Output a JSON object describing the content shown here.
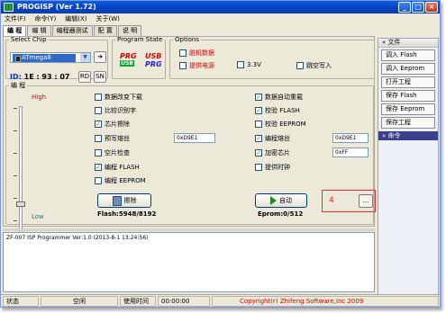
{
  "window": {
    "title": "PROGISP (Ver 1.72)"
  },
  "menu": [
    "文件(F)",
    "命令(Y)",
    "编辑(X)",
    "关于(W)"
  ],
  "tabs": [
    "编 程",
    "编 辑",
    "编程器测试",
    "配 置",
    "说 明"
  ],
  "select_chip": {
    "legend": "Select Chip",
    "chip": "ATmega8",
    "id_label": "ID:",
    "id_value": "1E : 93 : 07",
    "rd": "RD",
    "sn": "SN"
  },
  "program_state": {
    "legend": "Program State",
    "prg_top": "PRG",
    "prg_bottom": "USB",
    "usb_top": "USB",
    "usb_bottom": "PRG"
  },
  "options": {
    "legend": "Options",
    "offline_data": "脱机数据",
    "supply_power": "提供电源",
    "voltage": "3.3V",
    "empty_write": "跳空写入"
  },
  "program": {
    "legend": "编 程",
    "high": "High",
    "low": "Low",
    "left_checks": [
      {
        "label": "数据改变下载",
        "checked": false
      },
      {
        "label": "比较识别字",
        "checked": false
      },
      {
        "label": "芯片擦除",
        "checked": true
      },
      {
        "label": "预写熔丝",
        "checked": false
      },
      {
        "label": "空片检查",
        "checked": false
      },
      {
        "label": "编程 FLASH",
        "checked": true
      },
      {
        "label": "编程 EEPROM",
        "checked": false
      }
    ],
    "right_checks": [
      {
        "label": "数据自动重载",
        "checked": true
      },
      {
        "label": "校验 FLASH",
        "checked": true
      },
      {
        "label": "校验 EEPROM",
        "checked": false
      },
      {
        "label": "编程熔丝",
        "checked": true
      },
      {
        "label": "加密芯片",
        "checked": true
      },
      {
        "label": "提供时钟",
        "checked": false
      }
    ],
    "prefuse_hex": "0xD9E1",
    "fuse_hex": "0xD9E1",
    "lock_hex": "0xFF",
    "erase_button": "擦除",
    "auto_button": "自动",
    "flash_usage": "Flash:5948/8192",
    "eprom_usage": "Eprom:0/512",
    "red_number": "4",
    "dots_button": "..."
  },
  "sidebar": {
    "file_header": "文件",
    "items": [
      "调入 Flash",
      "调入 Eeprom",
      "打开工程",
      "保存 Flash",
      "保存 Eeprom",
      "保存工程"
    ],
    "cmd_header": "命令"
  },
  "log": {
    "line": "ZF-007 ISP Programmer Ver:1.0 (2013-8-1 13:24:56)"
  },
  "status": {
    "label": "状态",
    "state": "空闲",
    "time_label": "使用时间",
    "time_value": "00:00:00",
    "copyright": "Copyright(r) Zhifeng Software,Inc 2009"
  },
  "colors": {
    "accent": "#0a5fe0",
    "highlight": "#e53030",
    "check": "#21a121"
  }
}
